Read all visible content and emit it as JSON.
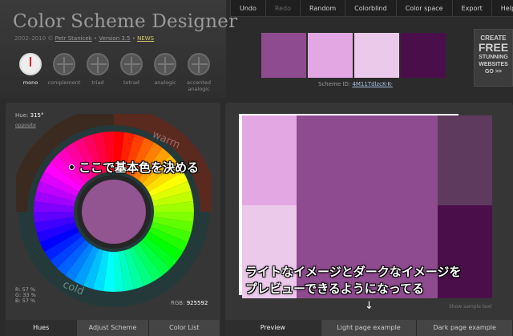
{
  "header": {
    "title": "Color Scheme Designer",
    "years": "2002–2010 © ",
    "author": "Petr Stanicek",
    "sep1": " • ",
    "version": "Version 3.5",
    "sep2": " • ",
    "news": "NEWS"
  },
  "modes": [
    {
      "label": "mono",
      "active": true
    },
    {
      "label": "complement"
    },
    {
      "label": "triad"
    },
    {
      "label": "tetrad"
    },
    {
      "label": "analogic"
    },
    {
      "label": "accented analogic"
    }
  ],
  "menu": [
    "Undo",
    "Redo",
    "Random",
    "Colorblind",
    "Color space",
    "Export",
    "Help"
  ],
  "swatches": [
    "#8f4b8f",
    "#e3a8e3",
    "#ebc9eb",
    "#4a0f4a"
  ],
  "scheme": {
    "label": "Scheme ID:",
    "id": "4M11TdlzcK-K-"
  },
  "ad": {
    "l1": "CREATE",
    "l2": "FREE",
    "l3": "STUNNING WEBSITES",
    "l4": "GO >>"
  },
  "wheel": {
    "hue_label": "Hue:",
    "hue_value": "315°",
    "opposite": "opposite",
    "warm": "warm",
    "cold": "cold",
    "r": "R: 57 %",
    "g": "G: 33 %",
    "b": "B: 57 %",
    "rgb_label": "RGB:",
    "rgb_value": "925592",
    "base_color": "#925592"
  },
  "left_tabs": [
    "Hues",
    "Adjust Scheme",
    "Color List"
  ],
  "right_tabs": [
    "Preview",
    "Light page example",
    "Dark page example"
  ],
  "show_sample": "Show sample text",
  "annotations": {
    "wheel_note": "ここで基本色を決める",
    "preview_line1": "ライトなイメージとダークなイメージを",
    "preview_line2": "プレビューできるようになってる",
    "arrow": "↓"
  },
  "preview_colors": {
    "light1": "#e3a8e3",
    "light2": "#ebc9eb",
    "main": "#8f4b8f",
    "dark1": "#5e3a5e",
    "dark2": "#4a0f4a"
  }
}
